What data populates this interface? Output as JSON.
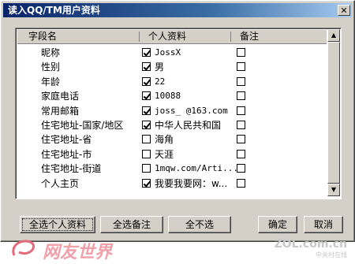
{
  "window": {
    "title": "读入QQ/TM用户资料",
    "close_glyph": "✕"
  },
  "columns": {
    "field": "字段名",
    "info": "个人资料",
    "note": "备注"
  },
  "rows": [
    {
      "field": "昵称",
      "checked": true,
      "value": "JossX",
      "note_checked": false
    },
    {
      "field": "性别",
      "checked": true,
      "value": "男",
      "note_checked": false
    },
    {
      "field": "年龄",
      "checked": true,
      "value": "22",
      "note_checked": false
    },
    {
      "field": "家庭电话",
      "checked": true,
      "value": "10088",
      "note_checked": false
    },
    {
      "field": "常用邮箱",
      "checked": true,
      "value": "joss_   @163.com",
      "note_checked": false
    },
    {
      "field": "住宅地址-国家/地区",
      "checked": true,
      "value": "中华人民共和国",
      "note_checked": false
    },
    {
      "field": "住宅地址-省",
      "checked": false,
      "value": "海角",
      "note_checked": false
    },
    {
      "field": "住宅地址-市",
      "checked": false,
      "value": "天涯",
      "note_checked": false
    },
    {
      "field": "住宅地址-街道",
      "checked": false,
      "value": "1mqw.com/Arti...",
      "note_checked": false
    },
    {
      "field": "个人主页",
      "checked": true,
      "value": "我要我要网：w...",
      "note_checked": false
    }
  ],
  "buttons": {
    "select_all_info": "全选个人资料",
    "select_all_notes": "全选备注",
    "select_none": "全不选",
    "ok": "确定",
    "cancel": "取消"
  },
  "watermark": {
    "left": "网友世界",
    "right": "ZOL.com.cn",
    "right_sub": "中关村在线"
  }
}
